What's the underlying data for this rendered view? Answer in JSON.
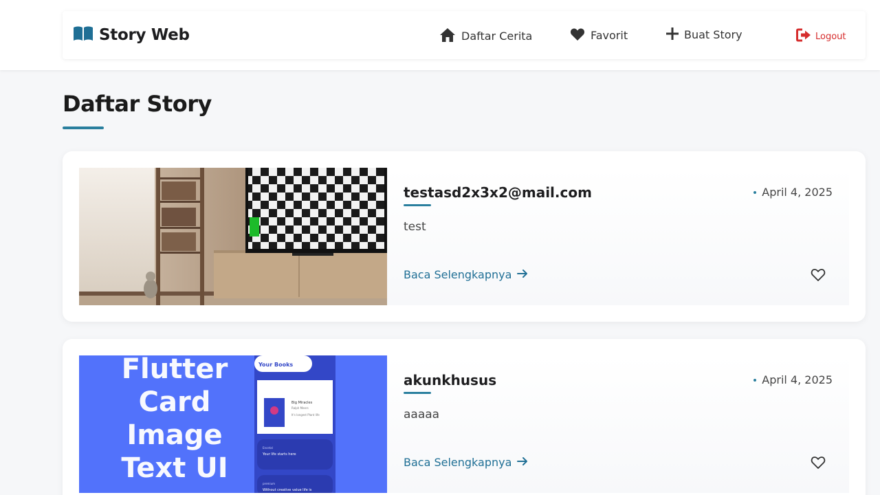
{
  "header": {
    "brand": "Story Web",
    "nav": [
      {
        "label": "Daftar Cerita",
        "icon": "home-icon"
      },
      {
        "label": "Favorit",
        "icon": "heart-icon"
      },
      {
        "label": "Buat Story",
        "icon": "plus-icon"
      }
    ],
    "logout_label": "Logout"
  },
  "page": {
    "title": "Daftar Story"
  },
  "stories": [
    {
      "author": "testasd2x3x2@mail.com",
      "date": "April 4, 2025",
      "description": "test",
      "read_more": "Baca Selengkapnya",
      "image": "room-with-tv-and-cat"
    },
    {
      "author": "akunkhusus",
      "date": "April 4, 2025",
      "description": "aaaaa",
      "read_more": "Baca Selengkapnya",
      "image": "flutter-card-ui",
      "image_text": [
        "Flutter",
        "Card",
        "Image",
        "Text UI"
      ],
      "image_panel": {
        "title": "Your Books",
        "book_title": "Big Miracles",
        "book_author": "Ralph Meers",
        "book_note": "It's longest Plant life",
        "banner1_small": "Encetal",
        "banner1_text": "Your life starts here",
        "banner2_small": "premium",
        "banner2_text": "Without creative value life is"
      }
    }
  ],
  "colors": {
    "accent": "#2a7f9e",
    "link": "#1f6f95",
    "logout": "#d62d2d",
    "brand_icon": "#1f6f95"
  }
}
